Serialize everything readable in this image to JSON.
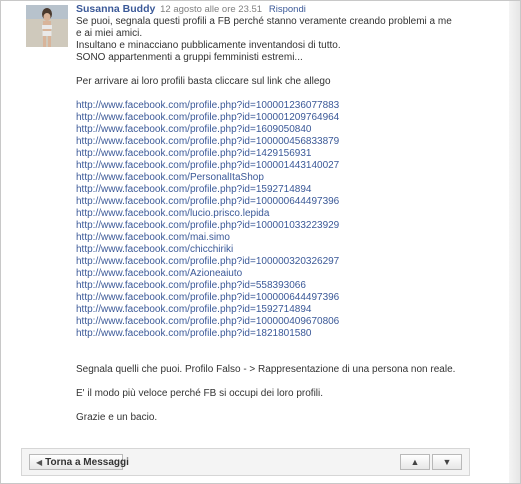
{
  "post": {
    "author": "Susanna Buddy",
    "timestamp": "12 agosto alle ore 23.51",
    "reply_label": "Rispondi",
    "intro_lines": [
      "Se puoi, segnala questi profili a FB perché stanno veramente creando problemi a me",
      "e ai miei amici.",
      "Insultano e minacciano pubblicamente inventandosi di tutto.",
      "SONO appartenmenti a gruppi femministi estremi..."
    ],
    "instruction": "Per arrivare ai loro profili basta cliccare sul link che allego",
    "links": [
      "http://www.facebook.com/profile.php?id=100001236077883",
      "http://www.facebook.com/profile.php?id=100001209764964",
      "http://www.facebook.com/profile.php?id=1609050840",
      "http://www.facebook.com/profile.php?id=100000456833879",
      "http://www.facebook.com/profile.php?id=1429156931",
      "http://www.facebook.com/profile.php?id=100001443140027",
      "http://www.facebook.com/PersonalItaShop",
      "http://www.facebook.com/profile.php?id=1592714894",
      "http://www.facebook.com/profile.php?id=100000644497396",
      "http://www.facebook.com/lucio.prisco.lepida",
      "http://www.facebook.com/profile.php?id=100001033223929",
      "http://www.facebook.com/mai.simo",
      "http://www.facebook.com/chicchiriki",
      "http://www.facebook.com/profile.php?id=100000320326297",
      "http://www.facebook.com/Azioneaiuto",
      "http://www.facebook.com/profile.php?id=558393066",
      "http://www.facebook.com/profile.php?id=100000644497396",
      "http://www.facebook.com/profile.php?id=1592714894",
      "http://www.facebook.com/profile.php?id=100000409670806",
      "http://www.facebook.com/profile.php?id=1821801580"
    ],
    "outro_1": "Segnala quelli che puoi. Profilo Falso - > Rappresentazione di una persona non reale.",
    "outro_2": "E' il modo più veloce perché FB si occupi dei loro profili.",
    "outro_3": "Grazie e un bacio."
  },
  "footer": {
    "back_label": "Torna a Messaggi",
    "back_icon": "triangle-left-icon",
    "up_icon": "triangle-up-icon",
    "down_icon": "triangle-down-icon"
  },
  "colors": {
    "link": "#3b5998",
    "text": "#333333",
    "meta": "#808080"
  }
}
